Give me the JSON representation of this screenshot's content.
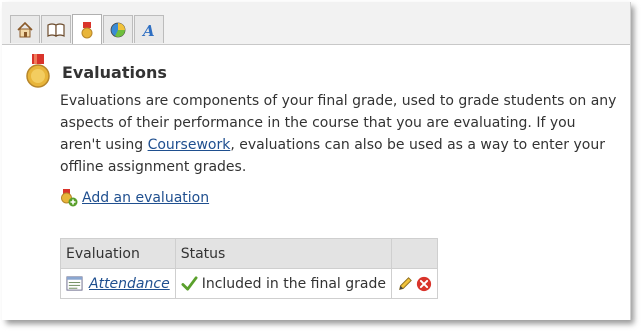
{
  "tabs": [
    {
      "icon": "home-icon",
      "active": false
    },
    {
      "icon": "book-icon",
      "active": false
    },
    {
      "icon": "medal-icon",
      "active": true
    },
    {
      "icon": "pie-chart-icon",
      "active": false
    },
    {
      "icon": "font-icon",
      "active": false
    }
  ],
  "page": {
    "title": "Evaluations",
    "description_part1": "Evaluations are components of your final grade, used to grade students on any aspects of their performance in the course that you are evaluating. If you aren't using ",
    "coursework_link": "Coursework",
    "description_part2": ", evaluations can also be used as a way to enter your offline assignment grades."
  },
  "add_link": "Add an evaluation",
  "table": {
    "headers": [
      "Evaluation",
      "Status",
      ""
    ],
    "rows": [
      {
        "evaluation": "Attendance",
        "status": "Included in the final grade"
      }
    ]
  },
  "colors": {
    "link": "#1f4f8f",
    "check": "#5aa02c",
    "delete": "#d9342b",
    "medal": "#e8b53a"
  }
}
